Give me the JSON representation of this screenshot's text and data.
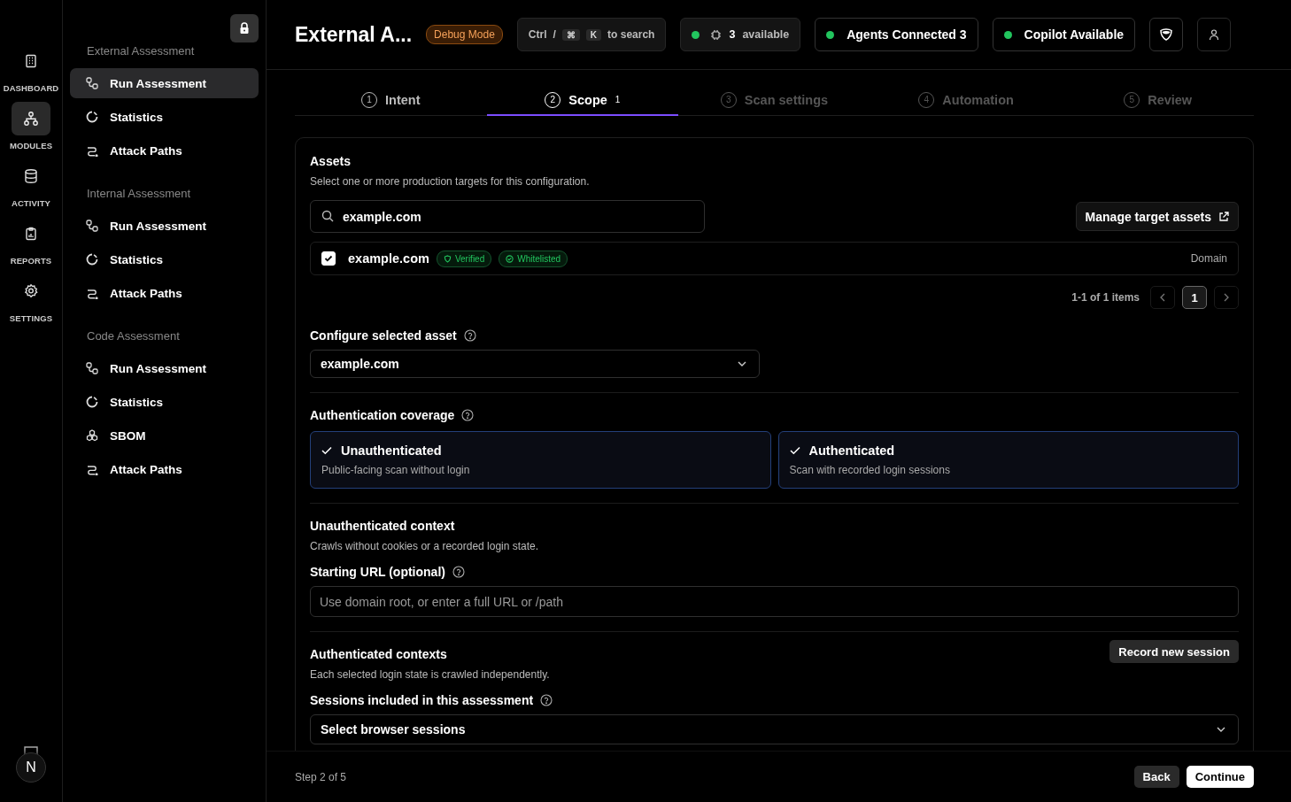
{
  "rail": [
    {
      "label": "DASHBOARD",
      "kind": "dashboard",
      "selected": false
    },
    {
      "label": "MODULES",
      "kind": "modules",
      "selected": true
    },
    {
      "label": "ACTIVITY",
      "kind": "activity",
      "selected": false
    },
    {
      "label": "REPORTS",
      "kind": "reports",
      "selected": false
    },
    {
      "label": "SETTINGS",
      "kind": "settings",
      "selected": false
    }
  ],
  "avatar": {
    "initial": "N"
  },
  "sidebar": {
    "groups": [
      {
        "title": "External Assessment",
        "items": [
          {
            "label": "Run Assessment",
            "kind": "run",
            "selected": true
          },
          {
            "label": "Statistics",
            "kind": "stats",
            "selected": false
          },
          {
            "label": "Attack Paths",
            "kind": "paths",
            "selected": false
          }
        ]
      },
      {
        "title": "Internal Assessment",
        "items": [
          {
            "label": "Run Assessment",
            "kind": "run",
            "selected": false
          },
          {
            "label": "Statistics",
            "kind": "stats",
            "selected": false
          },
          {
            "label": "Attack Paths",
            "kind": "paths",
            "selected": false
          }
        ]
      },
      {
        "title": "Code Assessment",
        "items": [
          {
            "label": "Run Assessment",
            "kind": "run",
            "selected": false
          },
          {
            "label": "Statistics",
            "kind": "stats",
            "selected": false
          },
          {
            "label": "SBOM",
            "kind": "sbom",
            "selected": false
          },
          {
            "label": "Attack Paths",
            "kind": "paths",
            "selected": false
          }
        ]
      }
    ]
  },
  "header": {
    "title": "External A...",
    "badge": "Debug Mode",
    "search": {
      "ctrl": "Ctrl",
      "slash": "/",
      "cmd": "⌘",
      "key": "K",
      "hint": "to search"
    },
    "status": [
      {
        "kind": "chip",
        "count": "3",
        "label": "available",
        "color": "#22c55e"
      },
      {
        "kind": "button",
        "label": "Agents Connected 3",
        "color": "#22c55e"
      },
      {
        "kind": "button",
        "label": "Copilot Available",
        "color": "#22c55e"
      }
    ]
  },
  "steps": [
    {
      "number": "1",
      "label": "Intent",
      "selected": false,
      "disabled": false
    },
    {
      "number": "2",
      "label": "Scope",
      "count": "1",
      "selected": true,
      "disabled": false
    },
    {
      "number": "3",
      "label": "Scan settings",
      "selected": false,
      "disabled": true
    },
    {
      "number": "4",
      "label": "Automation",
      "selected": false,
      "disabled": true
    },
    {
      "number": "5",
      "label": "Review",
      "selected": false,
      "disabled": true
    }
  ],
  "assets": {
    "title": "Assets",
    "subtitle": "Select one or more production targets for this configuration.",
    "search_value": "example.com",
    "manage_button": "Manage target assets",
    "rows": [
      {
        "name": "example.com",
        "checked": true,
        "tags": [
          "Verified",
          "Whitelisted"
        ],
        "type": "Domain"
      }
    ],
    "pagination": {
      "summary": "1-1 of 1 items",
      "pages": [
        {
          "label": "1",
          "selected": true
        }
      ]
    }
  },
  "configure": {
    "label": "Configure selected asset",
    "value": "example.com"
  },
  "coverage": {
    "label": "Authentication coverage",
    "options": [
      {
        "title": "Unauthenticated",
        "description": "Public-facing scan without login",
        "selected": true
      },
      {
        "title": "Authenticated",
        "description": "Scan with recorded login sessions",
        "selected": true
      }
    ]
  },
  "unauth": {
    "title": "Unauthenticated context",
    "subtitle": "Crawls without cookies or a recorded login state.",
    "url_label": "Starting URL (optional)",
    "url_placeholder": "Use domain root, or enter a full URL or /path"
  },
  "auth": {
    "title": "Authenticated contexts",
    "subtitle": "Each selected login state is crawled independently.",
    "record_button": "Record new session",
    "sessions_label": "Sessions included in this assessment",
    "sessions_placeholder": "Select browser sessions"
  },
  "footer": {
    "step": "Step 2 of 5",
    "back": "Back",
    "continue": "Continue"
  }
}
